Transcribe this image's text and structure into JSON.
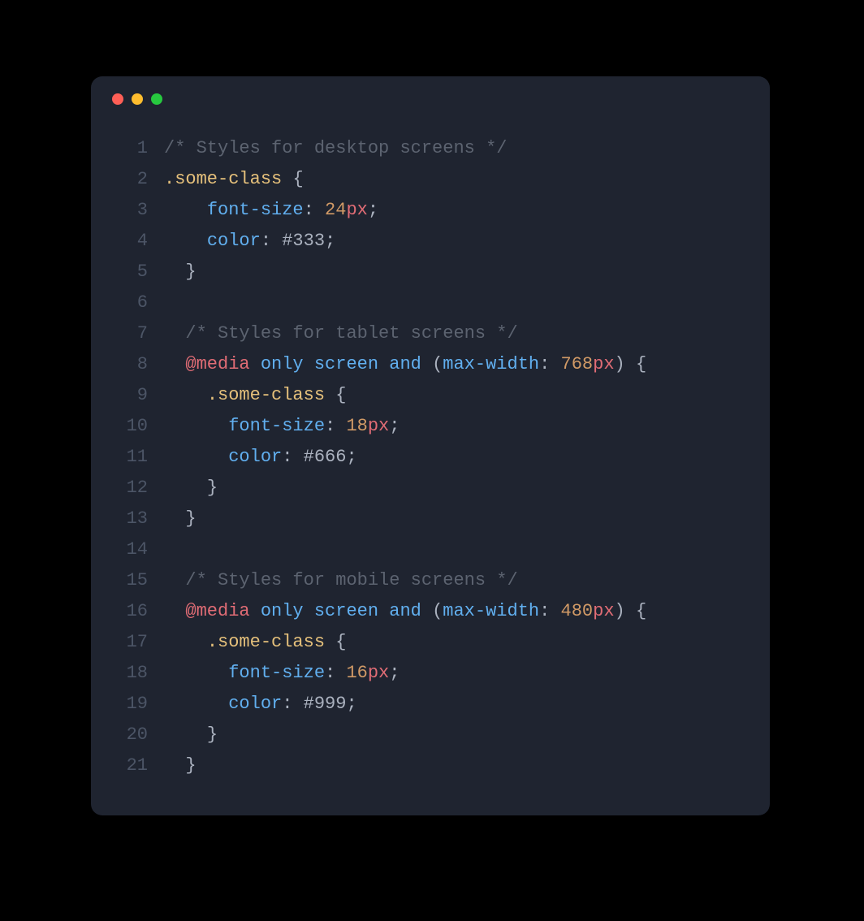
{
  "window": {
    "traffic_lights": [
      "close",
      "minimize",
      "zoom"
    ]
  },
  "code": {
    "language": "css",
    "lines": [
      {
        "n": "1",
        "tokens": [
          {
            "t": "/* Styles for desktop screens */",
            "c": "comment"
          }
        ]
      },
      {
        "n": "2",
        "tokens": [
          {
            "t": ".some-class",
            "c": "selector"
          },
          {
            "t": " ",
            "c": "punct"
          },
          {
            "t": "{",
            "c": "punct"
          }
        ]
      },
      {
        "n": "3",
        "tokens": [
          {
            "t": "    ",
            "c": "punct"
          },
          {
            "t": "font-size",
            "c": "prop"
          },
          {
            "t": ": ",
            "c": "punct"
          },
          {
            "t": "24",
            "c": "number"
          },
          {
            "t": "px",
            "c": "unit"
          },
          {
            "t": ";",
            "c": "punct"
          }
        ]
      },
      {
        "n": "4",
        "tokens": [
          {
            "t": "    ",
            "c": "punct"
          },
          {
            "t": "color",
            "c": "prop"
          },
          {
            "t": ": ",
            "c": "punct"
          },
          {
            "t": "#333",
            "c": "hex"
          },
          {
            "t": ";",
            "c": "punct"
          }
        ]
      },
      {
        "n": "5",
        "tokens": [
          {
            "t": "  ",
            "c": "punct"
          },
          {
            "t": "}",
            "c": "punct"
          }
        ]
      },
      {
        "n": "6",
        "tokens": [
          {
            "t": "",
            "c": "punct"
          }
        ]
      },
      {
        "n": "7",
        "tokens": [
          {
            "t": "  ",
            "c": "punct"
          },
          {
            "t": "/* Styles for tablet screens */",
            "c": "comment"
          }
        ]
      },
      {
        "n": "8",
        "tokens": [
          {
            "t": "  ",
            "c": "punct"
          },
          {
            "t": "@media",
            "c": "keyword"
          },
          {
            "t": " ",
            "c": "punct"
          },
          {
            "t": "only",
            "c": "media-kw"
          },
          {
            "t": " ",
            "c": "punct"
          },
          {
            "t": "screen",
            "c": "media-kw"
          },
          {
            "t": " ",
            "c": "punct"
          },
          {
            "t": "and",
            "c": "media-kw"
          },
          {
            "t": " (",
            "c": "punct"
          },
          {
            "t": "max-width",
            "c": "prop"
          },
          {
            "t": ": ",
            "c": "punct"
          },
          {
            "t": "768",
            "c": "number"
          },
          {
            "t": "px",
            "c": "unit"
          },
          {
            "t": ") ",
            "c": "punct"
          },
          {
            "t": "{",
            "c": "punct"
          }
        ]
      },
      {
        "n": "9",
        "tokens": [
          {
            "t": "    ",
            "c": "punct"
          },
          {
            "t": ".some-class",
            "c": "selector"
          },
          {
            "t": " ",
            "c": "punct"
          },
          {
            "t": "{",
            "c": "punct"
          }
        ]
      },
      {
        "n": "10",
        "tokens": [
          {
            "t": "      ",
            "c": "punct"
          },
          {
            "t": "font-size",
            "c": "prop"
          },
          {
            "t": ": ",
            "c": "punct"
          },
          {
            "t": "18",
            "c": "number"
          },
          {
            "t": "px",
            "c": "unit"
          },
          {
            "t": ";",
            "c": "punct"
          }
        ]
      },
      {
        "n": "11",
        "tokens": [
          {
            "t": "      ",
            "c": "punct"
          },
          {
            "t": "color",
            "c": "prop"
          },
          {
            "t": ": ",
            "c": "punct"
          },
          {
            "t": "#666",
            "c": "hex"
          },
          {
            "t": ";",
            "c": "punct"
          }
        ]
      },
      {
        "n": "12",
        "tokens": [
          {
            "t": "    ",
            "c": "punct"
          },
          {
            "t": "}",
            "c": "punct"
          }
        ]
      },
      {
        "n": "13",
        "tokens": [
          {
            "t": "  ",
            "c": "punct"
          },
          {
            "t": "}",
            "c": "punct"
          }
        ]
      },
      {
        "n": "14",
        "tokens": [
          {
            "t": "",
            "c": "punct"
          }
        ]
      },
      {
        "n": "15",
        "tokens": [
          {
            "t": "  ",
            "c": "punct"
          },
          {
            "t": "/* Styles for mobile screens */",
            "c": "comment"
          }
        ]
      },
      {
        "n": "16",
        "tokens": [
          {
            "t": "  ",
            "c": "punct"
          },
          {
            "t": "@media",
            "c": "keyword"
          },
          {
            "t": " ",
            "c": "punct"
          },
          {
            "t": "only",
            "c": "media-kw"
          },
          {
            "t": " ",
            "c": "punct"
          },
          {
            "t": "screen",
            "c": "media-kw"
          },
          {
            "t": " ",
            "c": "punct"
          },
          {
            "t": "and",
            "c": "media-kw"
          },
          {
            "t": " (",
            "c": "punct"
          },
          {
            "t": "max-width",
            "c": "prop"
          },
          {
            "t": ": ",
            "c": "punct"
          },
          {
            "t": "480",
            "c": "number"
          },
          {
            "t": "px",
            "c": "unit"
          },
          {
            "t": ") ",
            "c": "punct"
          },
          {
            "t": "{",
            "c": "punct"
          }
        ]
      },
      {
        "n": "17",
        "tokens": [
          {
            "t": "    ",
            "c": "punct"
          },
          {
            "t": ".some-class",
            "c": "selector"
          },
          {
            "t": " ",
            "c": "punct"
          },
          {
            "t": "{",
            "c": "punct"
          }
        ]
      },
      {
        "n": "18",
        "tokens": [
          {
            "t": "      ",
            "c": "punct"
          },
          {
            "t": "font-size",
            "c": "prop"
          },
          {
            "t": ": ",
            "c": "punct"
          },
          {
            "t": "16",
            "c": "number"
          },
          {
            "t": "px",
            "c": "unit"
          },
          {
            "t": ";",
            "c": "punct"
          }
        ]
      },
      {
        "n": "19",
        "tokens": [
          {
            "t": "      ",
            "c": "punct"
          },
          {
            "t": "color",
            "c": "prop"
          },
          {
            "t": ": ",
            "c": "punct"
          },
          {
            "t": "#999",
            "c": "hex"
          },
          {
            "t": ";",
            "c": "punct"
          }
        ]
      },
      {
        "n": "20",
        "tokens": [
          {
            "t": "    ",
            "c": "punct"
          },
          {
            "t": "}",
            "c": "punct"
          }
        ]
      },
      {
        "n": "21",
        "tokens": [
          {
            "t": "  ",
            "c": "punct"
          },
          {
            "t": "}",
            "c": "punct"
          }
        ]
      }
    ]
  }
}
